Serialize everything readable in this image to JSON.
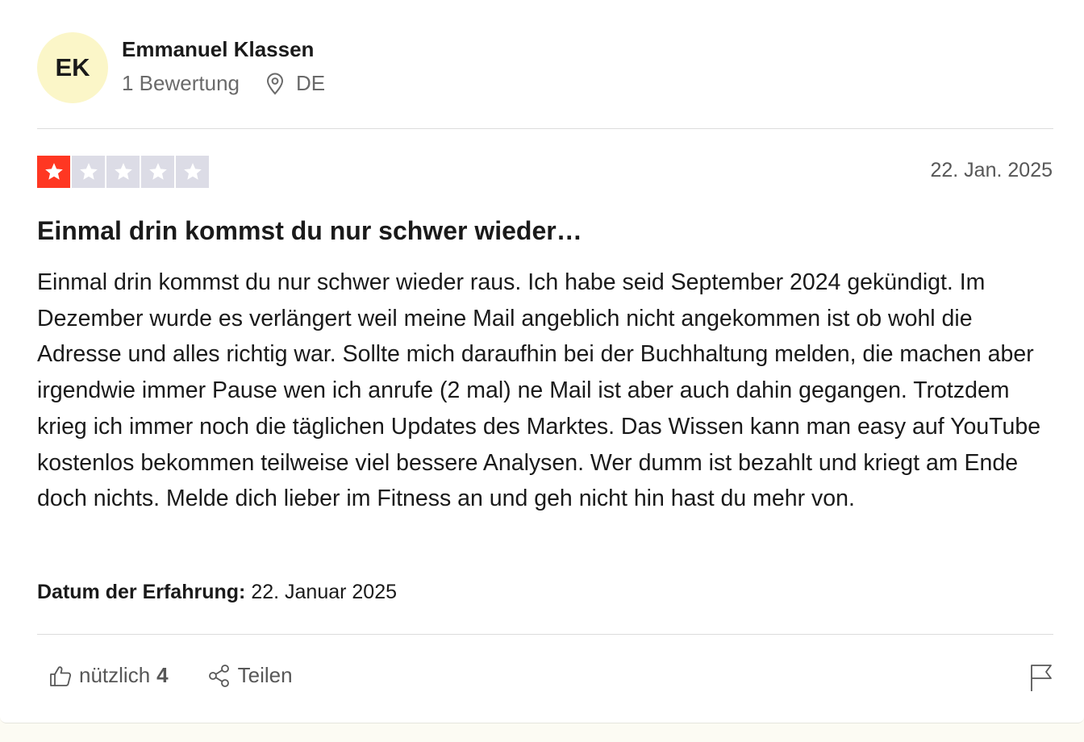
{
  "reviewer": {
    "initials": "EK",
    "name": "Emmanuel Klassen",
    "review_count": "1 Bewertung",
    "country": "DE"
  },
  "review": {
    "rating": 1,
    "max_rating": 5,
    "date": "22. Jan. 2025",
    "title": "Einmal drin kommst du nur schwer wieder…",
    "body": "Einmal drin kommst du nur schwer wieder raus. Ich habe seid September 2024 gekündigt. Im Dezember wurde es verlängert weil meine Mail angeblich nicht angekommen ist ob wohl die Adresse und alles richtig war. Sollte mich daraufhin bei der Buchhaltung melden, die machen aber irgendwie immer Pause wen ich anrufe (2 mal) ne Mail ist aber auch dahin gegangen. Trotzdem krieg ich immer noch die täglichen Updates des Marktes. Das Wissen kann man easy auf YouTube kostenlos bekommen teilweise viel bessere Analysen. Wer dumm ist bezahlt und kriegt am Ende doch nichts. Melde dich lieber im Fitness an und geh nicht hin hast du mehr von.",
    "experience_label": "Datum der Erfahrung:",
    "experience_date": "22. Januar 2025"
  },
  "actions": {
    "useful_label": "nützlich",
    "useful_count": "4",
    "share_label": "Teilen"
  },
  "colors": {
    "star_filled": "#ff3722",
    "star_empty": "#dcdce6",
    "avatar_bg": "#fbf6c8"
  },
  "icons": [
    "location-pin-icon",
    "star-icon",
    "thumbs-up-icon",
    "share-icon",
    "flag-icon"
  ]
}
